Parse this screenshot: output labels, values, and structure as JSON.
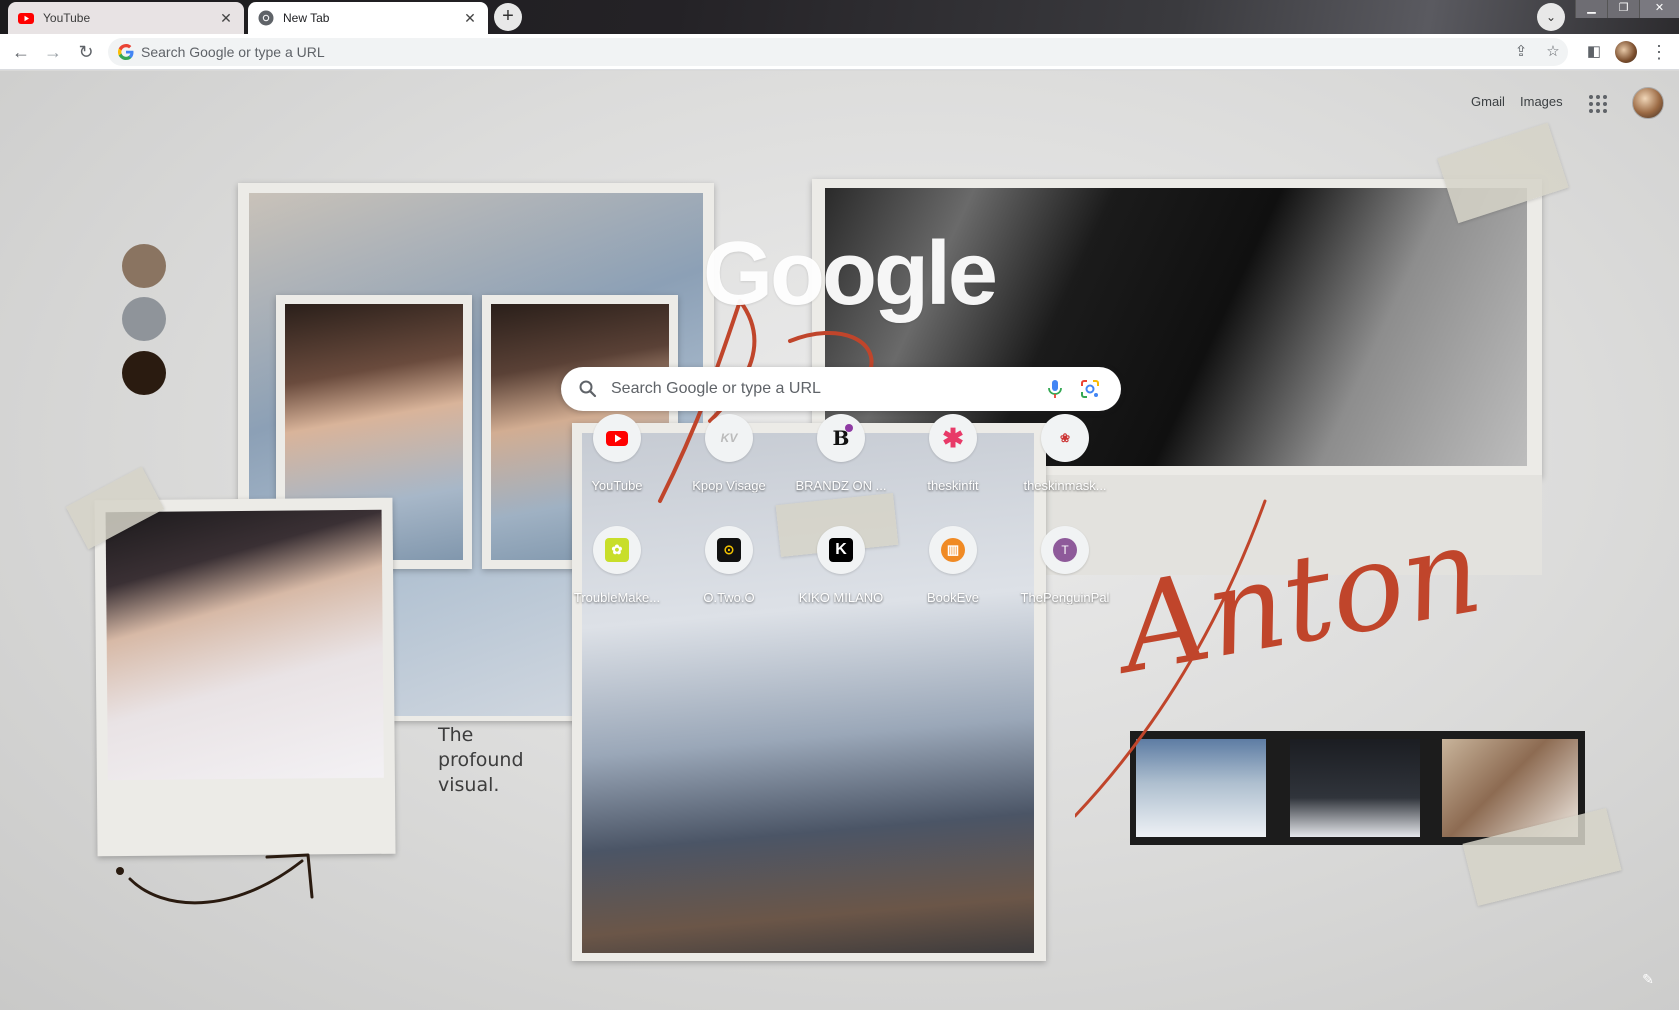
{
  "browser": {
    "tabs": [
      {
        "title": "YouTube",
        "active": false,
        "favicon": "youtube-icon"
      },
      {
        "title": "New Tab",
        "active": true,
        "favicon": "chrome-icon"
      }
    ],
    "new_tab_symbol": "+",
    "window_controls": [
      "minimize",
      "restore",
      "close"
    ],
    "omnibox": {
      "placeholder": "Search Google or type a URL",
      "value": ""
    }
  },
  "ntp": {
    "top_links": {
      "gmail": "Gmail",
      "images": "Images"
    },
    "logo_text": "Google",
    "search": {
      "placeholder": "Search Google or type a URL"
    },
    "shortcuts": [
      {
        "label": "YouTube",
        "icon": "youtube-icon",
        "color": "#ff0000"
      },
      {
        "label": "Kpop Visage",
        "icon": "kv-logo-icon",
        "color": "#cfcfcf"
      },
      {
        "label": "BRANDZ ON ...",
        "icon": "brandz-icon",
        "color": "#ffffff"
      },
      {
        "label": "theskinfit",
        "icon": "asterisk-icon",
        "color": "#e83a68"
      },
      {
        "label": "theskinmask...",
        "icon": "skinmask-icon",
        "color": "#f5f5f5"
      },
      {
        "label": "TroubleMake...",
        "icon": "troublemaker-icon",
        "color": "#c8de2a"
      },
      {
        "label": "O.Two.O",
        "icon": "otwoo-icon",
        "color": "#111111"
      },
      {
        "label": "KIKO MILANO",
        "icon": "kiko-icon",
        "color": "#000000"
      },
      {
        "label": "BookEve",
        "icon": "book-icon",
        "color": "#f08a24"
      },
      {
        "label": "ThePenguinPal",
        "icon": "letter-t-icon",
        "color": "#8e5a9a"
      }
    ]
  },
  "theme": {
    "script_word": "Anton",
    "caption_lines": [
      "The",
      "profound",
      "visual."
    ],
    "swatches": [
      "#8a7461",
      "#8f949a",
      "#2a1b10"
    ]
  },
  "colors": {
    "accent": "#c0452b",
    "tab_bg": "#e8e3e4",
    "chrome_dark": "#1c1b1d"
  }
}
